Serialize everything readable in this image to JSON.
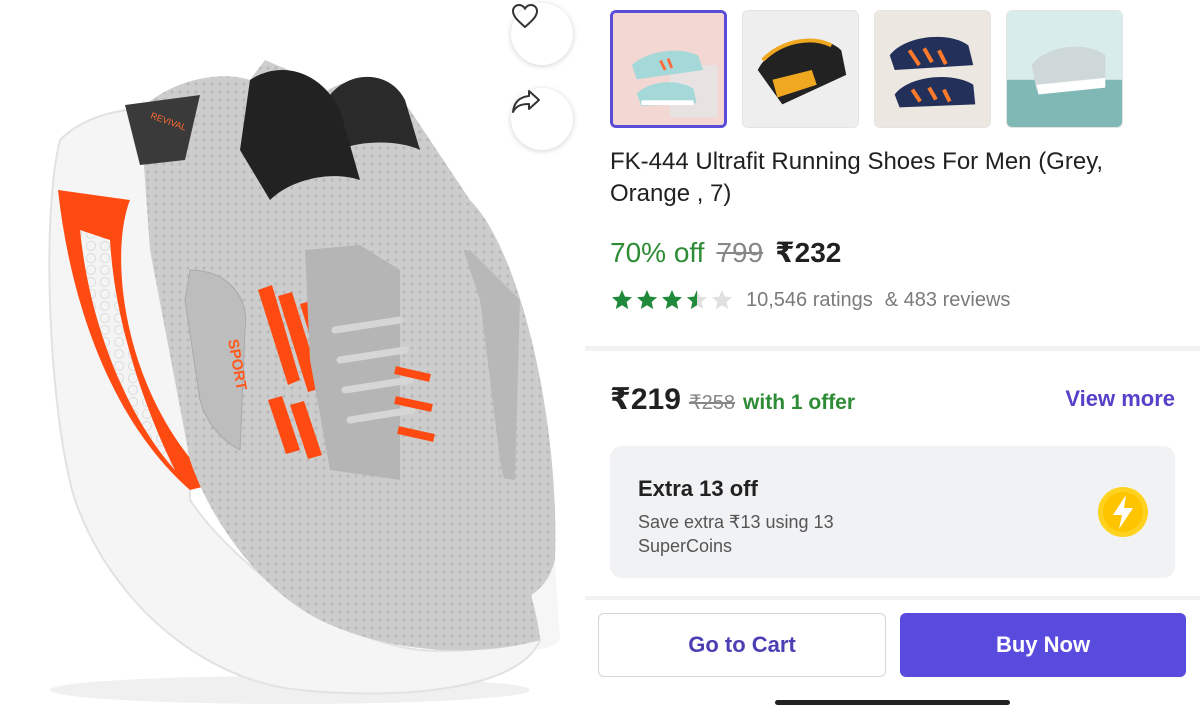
{
  "actions": {
    "wishlist_icon": "heart-icon",
    "share_icon": "share-icon"
  },
  "thumbnails": [
    {
      "name": "thumbnail-1",
      "selected": true
    },
    {
      "name": "thumbnail-2",
      "selected": false
    },
    {
      "name": "thumbnail-3",
      "selected": false
    },
    {
      "name": "thumbnail-4",
      "selected": false
    }
  ],
  "hero_print": {
    "sport": "SPORT",
    "tongue": "REVIVAL"
  },
  "product": {
    "title": "FK-444 Ultrafit Running Shoes For Men (Grey, Orange , 7)",
    "discount": "70% off",
    "mrp": "799",
    "price": "₹232",
    "rating_stars": 3.5,
    "ratings": "10,546 ratings",
    "reviews": "& 483 reviews"
  },
  "offer": {
    "price": "₹219",
    "mrp": "₹258",
    "text": "with 1 offer",
    "view_more": "View more"
  },
  "supercoins": {
    "title": "Extra 13 off",
    "description": "Save extra ₹13 using 13 SuperCoins",
    "icon": "lightning-coin-icon"
  },
  "buttons": {
    "cart": "Go to Cart",
    "buy": "Buy Now"
  },
  "colors": {
    "brand": "#5a4bdf",
    "discount_green": "#2e8b36",
    "star_green": "#1f8a3a",
    "shoe_orange": "#ff4b12",
    "shoe_grey": "#c9c9c9"
  }
}
